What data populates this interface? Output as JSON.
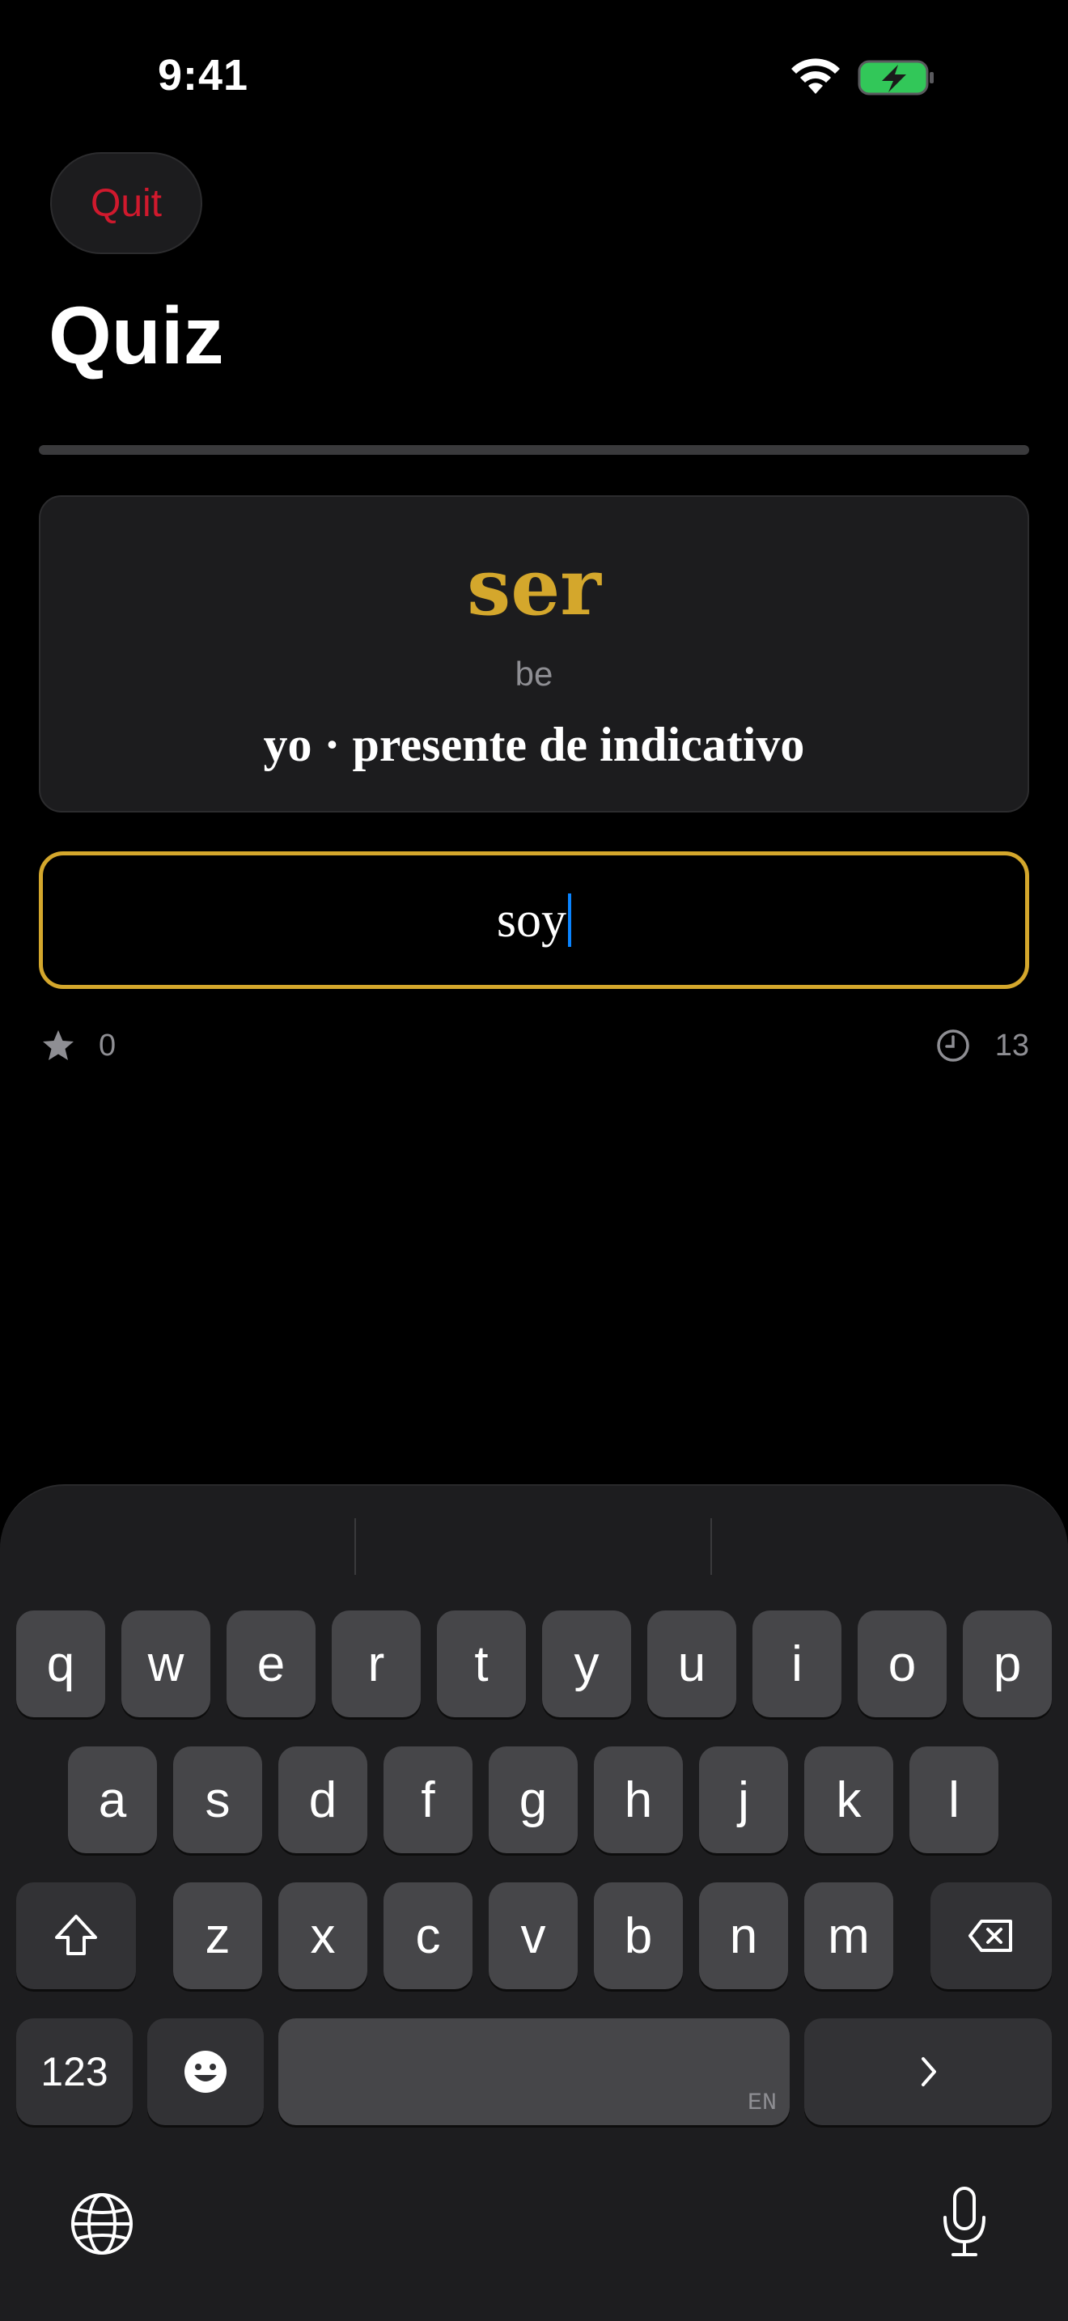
{
  "status_bar": {
    "time": "9:41"
  },
  "toolbar": {
    "quit_label": "Quit"
  },
  "title": "Quiz",
  "progress": 0.0,
  "prompt": {
    "verb": "ser",
    "meaning": "be",
    "conjugation": "yo · presente de indicativo"
  },
  "answer": {
    "value": "soy"
  },
  "stats": {
    "score": "0",
    "remaining": "13"
  },
  "keyboard": {
    "row1": [
      "q",
      "w",
      "e",
      "r",
      "t",
      "y",
      "u",
      "i",
      "o",
      "p"
    ],
    "row2": [
      "a",
      "s",
      "d",
      "f",
      "g",
      "h",
      "j",
      "k",
      "l"
    ],
    "row3": [
      "z",
      "x",
      "c",
      "v",
      "b",
      "n",
      "m"
    ],
    "numbers_label": "123",
    "language_label": "EN"
  },
  "colors": {
    "accent": "#d4a72c",
    "destructive": "#d0192d",
    "battery": "#32c759",
    "caret": "#0a84ff"
  }
}
